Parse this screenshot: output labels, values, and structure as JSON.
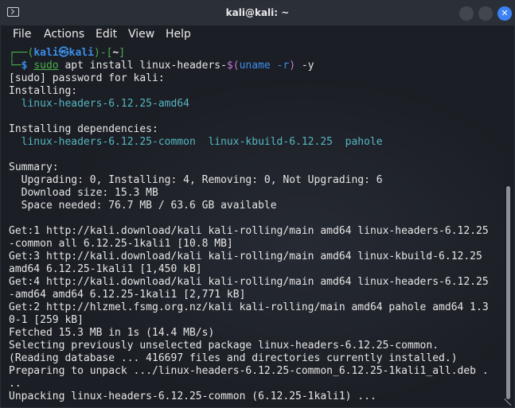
{
  "window": {
    "title": "kali@kali: ~"
  },
  "icons": {
    "terminal": "terminal-icon",
    "minimize": "minimize-icon",
    "maximize": "maximize-icon",
    "close": "close-icon",
    "close_glyph": "✕"
  },
  "menu": [
    "File",
    "Actions",
    "Edit",
    "View",
    "Help"
  ],
  "prompt": {
    "line1_prefix": "┌──(",
    "user_host": "kali㉿kali",
    "line1_mid": ")-[",
    "path": "~",
    "line1_suffix": "]",
    "line2_prefix": "└─",
    "dollar": "$ ",
    "cmd_sudo": "sudo",
    "cmd_rest1": " apt install linux-headers-",
    "cmd_subst_open": "$(",
    "cmd_uname": "uname",
    "cmd_flag": " -r",
    "cmd_subst_close": ")",
    "cmd_rest2": " -y"
  },
  "output": [
    "[sudo] password for kali:",
    "Installing:",
    "  linux-headers-6.12.25-amd64",
    "",
    "Installing dependencies:",
    "  linux-headers-6.12.25-common  linux-kbuild-6.12.25  pahole",
    "",
    "Summary:",
    "  Upgrading: 0, Installing: 4, Removing: 0, Not Upgrading: 6",
    "  Download size: 15.3 MB",
    "  Space needed: 76.7 MB / 63.6 GB available",
    "",
    "Get:1 http://kali.download/kali kali-rolling/main amd64 linux-headers-6.12.25",
    "-common all 6.12.25-1kali1 [10.8 MB]",
    "Get:3 http://kali.download/kali kali-rolling/main amd64 linux-kbuild-6.12.25",
    "amd64 6.12.25-1kali1 [1,450 kB]",
    "Get:4 http://kali.download/kali kali-rolling/main amd64 linux-headers-6.12.25",
    "-amd64 amd64 6.12.25-1kali1 [2,771 kB]",
    "Get:2 http://hlzmel.fsmg.org.nz/kali kali-rolling/main amd64 pahole amd64 1.3",
    "0-1 [259 kB]",
    "Fetched 15.3 MB in 1s (14.4 MB/s)",
    "Selecting previously unselected package linux-headers-6.12.25-common.",
    "(Reading database ... 416697 files and directories currently installed.)",
    "Preparing to unpack .../linux-headers-6.12.25-common_6.12.25-1kali1_all.deb .",
    "..",
    "Unpacking linux-headers-6.12.25-common (6.12.25-1kali1) ..."
  ]
}
